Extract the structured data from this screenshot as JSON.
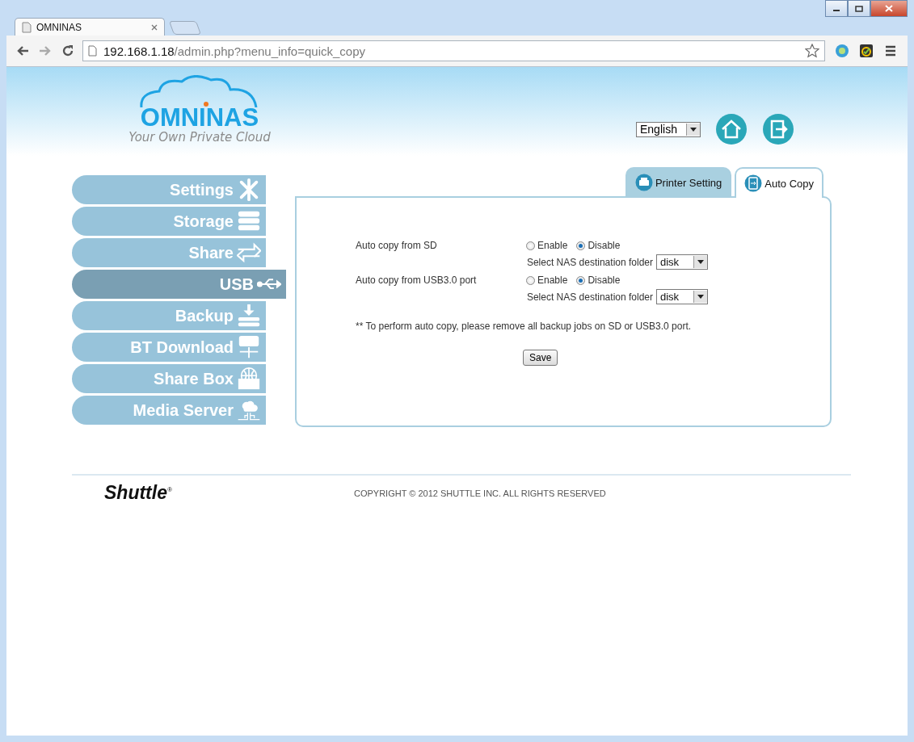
{
  "browser": {
    "tab_title": "OMNINAS",
    "url_host": "192.168.1.18",
    "url_path": "/admin.php?menu_info=quick_copy"
  },
  "header": {
    "logo_text": "OMNINAS",
    "tagline": "Your Own Private Cloud",
    "language": "English"
  },
  "sidebar": {
    "items": [
      {
        "label": "Settings",
        "kind": "tools",
        "selected": false
      },
      {
        "label": "Storage",
        "kind": "storage",
        "selected": false
      },
      {
        "label": "Share",
        "kind": "share",
        "selected": false
      },
      {
        "label": "USB",
        "kind": "usb",
        "selected": true
      },
      {
        "label": "Backup",
        "kind": "backup",
        "selected": false
      },
      {
        "label": "BT Download",
        "kind": "bt",
        "selected": false
      },
      {
        "label": "Share Box",
        "kind": "globe",
        "selected": false
      },
      {
        "label": "Media Server",
        "kind": "media",
        "selected": false
      }
    ]
  },
  "tabs": [
    {
      "label": "Printer Setting",
      "kind": "printer",
      "selected": false
    },
    {
      "label": "Auto Copy",
      "kind": "copy",
      "selected": true
    }
  ],
  "rows": [
    {
      "label": "Auto copy from SD",
      "options": [
        {
          "label": "Enable",
          "selected": false
        },
        {
          "label": "Disable",
          "selected": true
        }
      ],
      "folder_label": "Select NAS destination folder",
      "folder": "disk"
    },
    {
      "label": "Auto copy from USB3.0 port",
      "options": [
        {
          "label": "Enable",
          "selected": false
        },
        {
          "label": "Disable",
          "selected": true
        }
      ],
      "folder_label": "Select NAS destination folder",
      "folder": "disk"
    }
  ],
  "note": "** To perform auto copy, please remove all backup jobs on SD or USB3.0 port.",
  "save": "Save",
  "footer": {
    "brand": "Shuttle$^{®}$",
    "copyright": "COPYRIGHT © 2012 SHUTTLE INC. ALL RIGHTS RESERVED"
  }
}
